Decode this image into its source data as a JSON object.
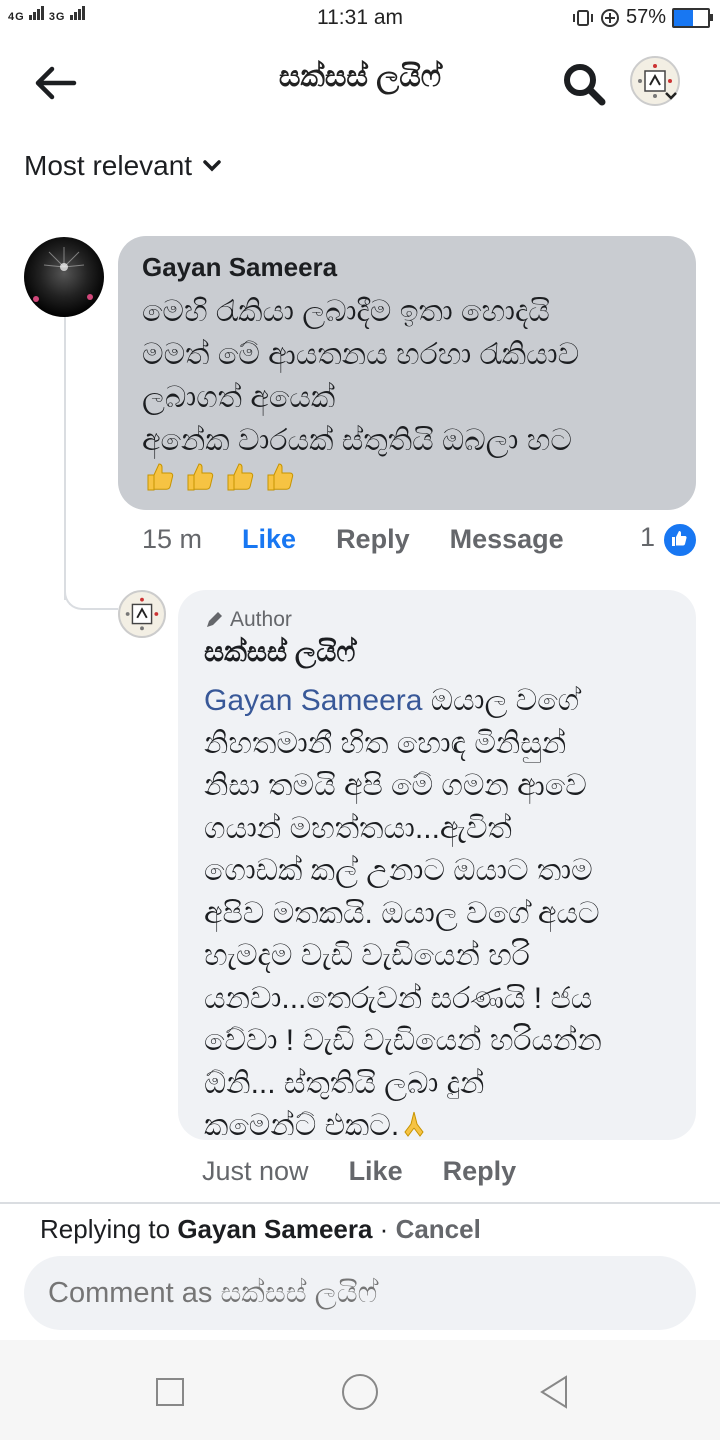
{
  "status_bar": {
    "network_left": "4G",
    "network_right": "3G",
    "time": "11:31 am",
    "battery": "57%",
    "battery_level": 0.57
  },
  "header": {
    "title": "සක්සස් ලයිෆ්"
  },
  "sort": {
    "label": "Most relevant"
  },
  "comment": {
    "author": "Gayan Sameera",
    "lines": [
      "මෙහි රැකියා ලබාදීම ඉතා හොදයි",
      "මමත් මේ ආයතනය හරහා රැකියාව",
      "ලබාගත් අයෙක්",
      "අනේක වාරයක් ස්තුතියි ඔබලා හට"
    ],
    "emoji_count": 4,
    "time": "15 m",
    "like_label": "Like",
    "reply_label": "Reply",
    "message_label": "Message",
    "reaction_count": "1"
  },
  "reply": {
    "badge": "Author",
    "author": "සක්සස් ලයිෆ්",
    "mention": "Gayan Sameera",
    "lines_first": " ඔයාල වගේ",
    "lines": [
      "නිහතමානී හිත හොඳ මිනිසුන්",
      "නිසා තමයි අපි මේ ගමන ආවෙ",
      "ගයාන් මහත්තයා...ඇවිත්",
      "ගොඩක් කල් උනාට ඔයාට තාම",
      "අපිව මතකයි. ඔයාල වගේ අයට",
      "හැමදම වැඩි වැඩියෙන් හරි",
      "යනවා...තෙරුවන් සරණයි ! ජය",
      "වේවා ! වැඩි වැඩියෙන් හරියන්න",
      "ඕනි... ස්තුතියි ලබා දුන්",
      "කමෙන්ට් එකට."
    ],
    "time": "Just now",
    "like_label": "Like",
    "reply_label": "Reply"
  },
  "composer": {
    "replying_prefix": "Replying to",
    "replying_name": "Gayan Sameera",
    "separator": " · ",
    "cancel_label": "Cancel",
    "placeholder": "Comment as සක්සස් ලයිෆ්"
  },
  "colors": {
    "accent": "#1877f2",
    "bubble_other": "#c9ccd1",
    "bubble_reply": "#f0f2f5",
    "secondary_text": "#65676b"
  },
  "icons": {
    "back": "arrow-left-icon",
    "search": "search-icon",
    "sort": "chevron-down-icon",
    "like_reaction": "thumbs-up-icon",
    "author": "pencil-icon"
  }
}
